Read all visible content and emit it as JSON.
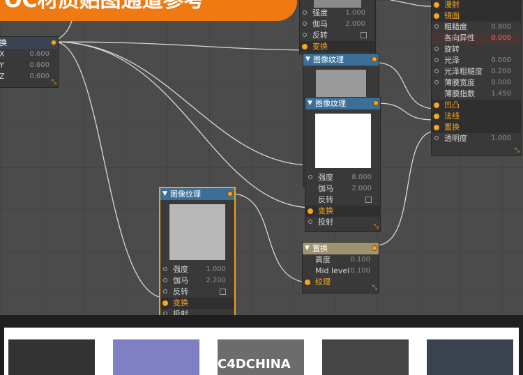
{
  "banner": {
    "title": "OC材质贴图通道参考"
  },
  "transform_node": {
    "header": "换",
    "rows": [
      {
        "label": "X",
        "value": "0.600"
      },
      {
        "label": "Y",
        "value": "0.600"
      },
      {
        "label": "Z",
        "value": "0.600"
      }
    ]
  },
  "tex_top": {
    "rows": [
      {
        "label": "强度",
        "value": "1.000"
      },
      {
        "label": "伽马",
        "value": "2.000"
      },
      {
        "label": "反转",
        "value": ""
      },
      {
        "label": "变换",
        "value": ""
      }
    ]
  },
  "tex_mid1": {
    "header": "图像纹理"
  },
  "tex_mid2": {
    "header": "图像纹理",
    "rows": [
      {
        "label": "强度",
        "value": "8.000"
      },
      {
        "label": "伽马",
        "value": "2.000"
      },
      {
        "label": "反转",
        "value": ""
      },
      {
        "label": "变换",
        "value": ""
      },
      {
        "label": "投射",
        "value": ""
      }
    ]
  },
  "tex_left": {
    "header": "图像纹理",
    "rows": [
      {
        "label": "强度",
        "value": "1.000"
      },
      {
        "label": "伽马",
        "value": "2.200"
      },
      {
        "label": "反转",
        "value": ""
      },
      {
        "label": "变换",
        "value": ""
      },
      {
        "label": "投射",
        "value": ""
      }
    ]
  },
  "displace": {
    "header": "置换",
    "rows": [
      {
        "label": "高度",
        "value": "0.100"
      },
      {
        "label": "Mid level",
        "value": "0.100"
      },
      {
        "label": "纹理",
        "value": ""
      }
    ]
  },
  "material": {
    "rows": [
      {
        "label": "漫射",
        "value": "",
        "hi": true
      },
      {
        "label": "镜面",
        "value": "",
        "hi": true
      },
      {
        "label": "粗糙度",
        "value": "0.800"
      },
      {
        "label": "各向异性",
        "value": "0.000",
        "red": true
      },
      {
        "label": "旋转",
        "value": ""
      },
      {
        "label": "光泽",
        "value": "0.000"
      },
      {
        "label": "光泽粗糙度",
        "value": "0.200"
      },
      {
        "label": "薄膜宽度",
        "value": "0.000"
      },
      {
        "label": "薄膜指数",
        "value": "1.450"
      },
      {
        "label": "凹凸",
        "value": "",
        "hi": true
      },
      {
        "label": "法线",
        "value": "",
        "hi": true
      },
      {
        "label": "置换",
        "value": "",
        "hi": true
      },
      {
        "label": "透明度",
        "value": "1.000"
      }
    ]
  },
  "swatches": [
    {
      "color": "#333333",
      "label": ""
    },
    {
      "color": "#7f7fc4",
      "label": ""
    },
    {
      "color": "#6c6c6c",
      "label": "C4DCHINA"
    },
    {
      "color": "#454545",
      "label": ""
    },
    {
      "color": "#3b4350",
      "label": ""
    }
  ],
  "colors": {
    "accent": "#f5a623",
    "header_blue": "#3b6f97",
    "banner": "#f07a12"
  }
}
